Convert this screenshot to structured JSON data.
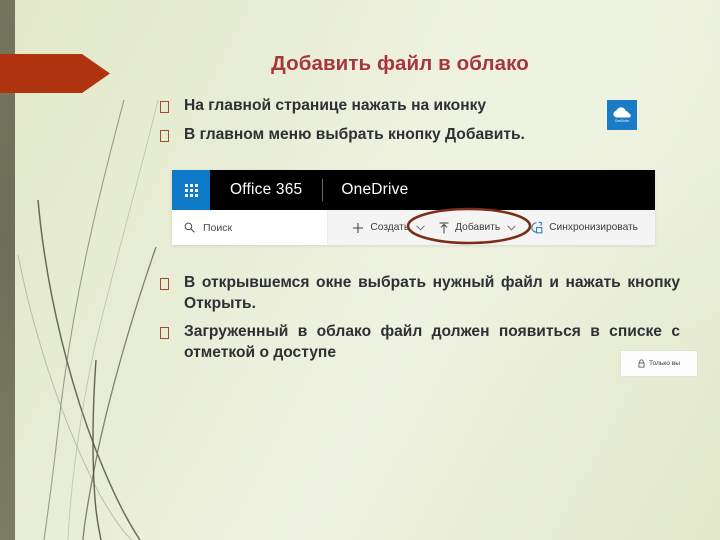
{
  "slide": {
    "title": "Добавить файл в облако",
    "title_color": "#A9353C",
    "background_color": "#E6EBD2",
    "accent_banner_color": "#B0330F",
    "left_band_color": "#75755E"
  },
  "bullets": [
    {
      "marker": "hollow-square-bullet",
      "text": "На главной странице нажать на иконку"
    },
    {
      "marker": "hollow-square-bullet",
      "text": "В главном меню выбрать кнопку Добавить."
    },
    {
      "marker": "hollow-square-bullet",
      "text": "В открывшемся окне выбрать нужный файл и нажать кнопку Открыть."
    },
    {
      "marker": "hollow-square-bullet",
      "text": "Загруженный в облако файл должен появиться в списке с отметкой о доступе"
    }
  ],
  "onedrive_tile": {
    "label": "OneDrive",
    "icon": "cloud-icon",
    "background_color": "#1B7BC4"
  },
  "only_you_badge": {
    "icon": "lock-icon",
    "label": "Только вы"
  },
  "screenshot": {
    "topbar": {
      "waffle_icon": "app-launcher-icon",
      "waffle_color": "#0F7AC8",
      "suite_name": "Office 365",
      "app_name": "OneDrive",
      "background_color": "#000000"
    },
    "toolbar": {
      "search_icon": "search-icon",
      "search_placeholder": "Поиск",
      "actions": [
        {
          "icon": "plus-icon",
          "label": "Создать",
          "has_chevron": true
        },
        {
          "icon": "upload-icon",
          "label": "Добавить",
          "has_chevron": true
        },
        {
          "icon": "sync-icon",
          "label": "Синхронизировать",
          "has_chevron": false
        }
      ]
    },
    "annotation": {
      "type": "ellipse-highlight",
      "target": "Добавить",
      "color": "#7C2D16"
    }
  }
}
